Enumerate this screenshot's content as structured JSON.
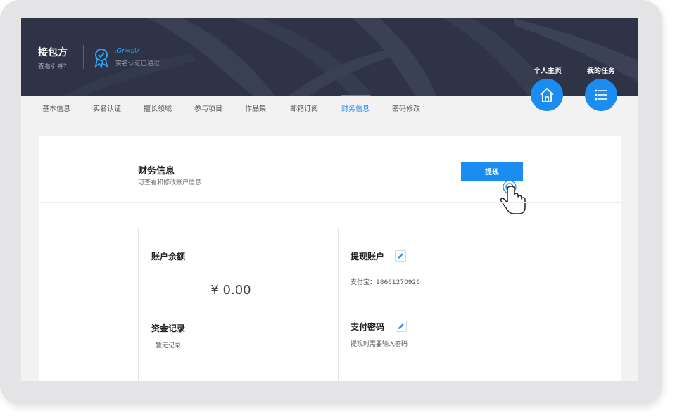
{
  "header": {
    "brand_name": "接包方",
    "brand_sub": "查看引导?",
    "cert_signature": "\\Gr=s\\/",
    "cert_text": "实名认证已通过",
    "links": [
      "个人主页",
      "我的任务"
    ],
    "icons": [
      "home-icon",
      "list-icon"
    ]
  },
  "tabs": [
    {
      "label": "基本信息"
    },
    {
      "label": "实名认证"
    },
    {
      "label": "擅长领域"
    },
    {
      "label": "参与项目"
    },
    {
      "label": "作品集"
    },
    {
      "label": "邮箱订阅"
    },
    {
      "label": "财务信息"
    },
    {
      "label": "密码修改"
    }
  ],
  "active_tab": "财务信息",
  "section": {
    "title": "财务信息",
    "subtitle": "可查看和修改账户信息",
    "withdraw_label": "提现"
  },
  "account_card": {
    "balance_title": "账户余额",
    "balance_value": "¥ 0.00",
    "records_title": "资金记录",
    "records_text": "暂无记录"
  },
  "withdraw_card": {
    "account_title": "提现账户",
    "account_text": "支付宝：18661270926",
    "password_title": "支付密码",
    "password_text": "提现时需要输入密码"
  },
  "colors": {
    "accent": "#1b8cf0",
    "header_bg": "#2e3446"
  }
}
